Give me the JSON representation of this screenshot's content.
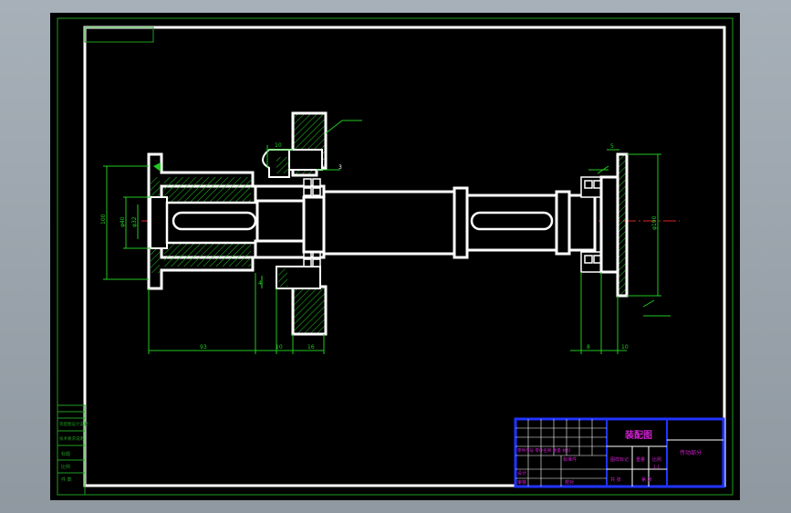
{
  "colors": {
    "viewport_bg": "#9aa3ab",
    "sheet_bg": "#000000",
    "border_outer": "#1f9e1f",
    "border_inner": "#ffffff",
    "part_outline": "#ffffff",
    "hatch": "#22c922",
    "dimension": "#22c922",
    "centerline": "#e02020",
    "title_block_frame": "#2233ff",
    "title_block_text": "#d020d0"
  },
  "dimensions": {
    "left_height": "100",
    "left_dia_outer": "φ40",
    "left_dia_inner": "φ32",
    "top_width": "10",
    "callout_3": "3",
    "small_right": "5",
    "right_dia": "φ190",
    "bottom_93": "93",
    "bottom_10": "10",
    "bottom_16": "16",
    "bottom_right_8": "8",
    "bottom_right_10": "10",
    "small_left": "4"
  },
  "side_table": {
    "rows": [
      "",
      "",
      "装配图设计说明",
      "技术要求说明",
      "标题",
      "比例",
      "件 数"
    ]
  },
  "title_block": {
    "title": "装配图",
    "right_label": "传动部分",
    "row1": "零件序号  零件名称  数量  材料",
    "row2": "标准件",
    "col_scale_label": "图样标记",
    "col_weight_label": "重量",
    "col_ratio_label": "比例",
    "ratio_value": "1:1",
    "designer": "设计",
    "checker": "审核",
    "sheet_label": "共 张",
    "page_label": "第 张",
    "check_label": "校对"
  }
}
